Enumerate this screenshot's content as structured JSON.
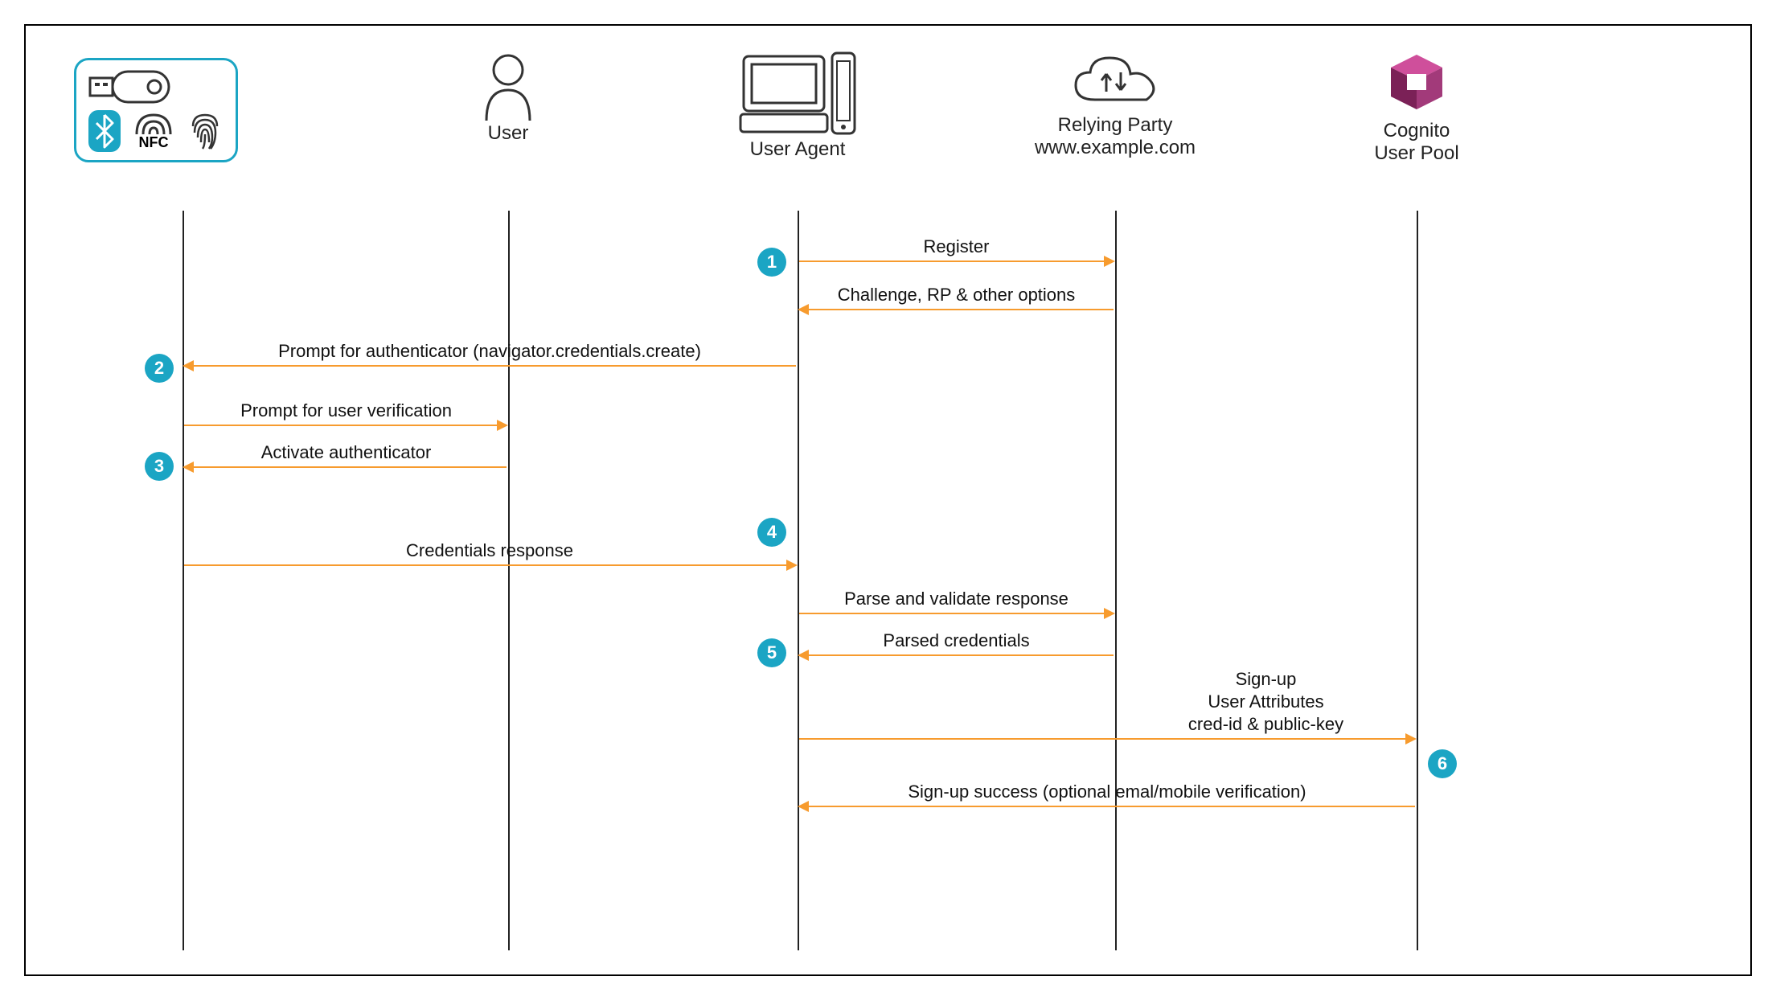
{
  "lanes": {
    "authenticator": {
      "label": ""
    },
    "user": {
      "label": "User"
    },
    "userAgent": {
      "label": "User Agent"
    },
    "relyingParty": {
      "label": "Relying Party",
      "sub": "www.example.com"
    },
    "cognito": {
      "label": "Cognito",
      "sub": "User Pool"
    }
  },
  "steps": {
    "s1": "1",
    "s2": "2",
    "s3": "3",
    "s4": "4",
    "s5": "5",
    "s6": "6"
  },
  "messages": {
    "m_register": "Register",
    "m_challenge": "Challenge, RP & other options",
    "m_prompt_auth": "Prompt for authenticator (navigator.credentials.create)",
    "m_prompt_uv": "Prompt for user verification",
    "m_activate": "Activate authenticator",
    "m_cred_resp": "Credentials response",
    "m_parse": "Parse and validate response",
    "m_parsed": "Parsed credentials",
    "m_signup_l1": "Sign-up",
    "m_signup_l2": "User Attributes",
    "m_signup_l3": "cred-id & public-key",
    "m_signup_ok": "Sign-up success (optional emal/mobile verification)"
  },
  "icons": {
    "nfc": "NFC"
  }
}
